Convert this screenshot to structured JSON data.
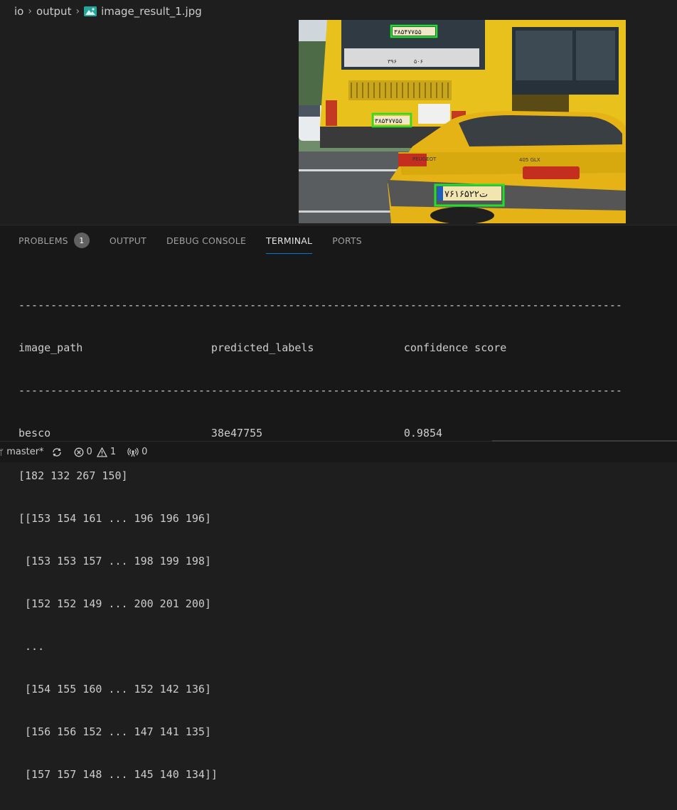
{
  "breadcrumb": {
    "items": [
      "io",
      "output"
    ],
    "file": "image_result_1.jpg"
  },
  "image": {
    "plates": [
      "۳۸۵۴۷۷۵۵",
      "۳۸۵۴۷۷۵۵",
      "۷۶ت۱۶۵۲۲"
    ],
    "bus_text": [
      "۳۹۶",
      "۵۰۶"
    ]
  },
  "panel": {
    "tabs": [
      {
        "label": "PROBLEMS",
        "badge": "1"
      },
      {
        "label": "OUTPUT"
      },
      {
        "label": "DEBUG CONSOLE"
      },
      {
        "label": "TERMINAL",
        "active": true
      },
      {
        "label": "PORTS"
      }
    ],
    "terminal_lines": [
      "----------------------------------------------------------------------------------------------",
      "image_path                    predicted_labels              confidence score",
      "----------------------------------------------------------------------------------------------",
      "besco                         38e47755                      0.9854",
      "[182 132 267 150]",
      "[[153 154 161 ... 196 196 196]",
      " [153 153 157 ... 198 199 198]",
      " [152 152 149 ... 200 201 200]",
      " ...",
      " [154 155 160 ... 152 142 136]",
      " [156 156 152 ... 147 141 135]",
      " [157 157 148 ... 145 140 134]]"
    ]
  },
  "statusbar": {
    "branch": "master*",
    "errors": "0",
    "warnings": "1",
    "ports": "0"
  },
  "colors": {
    "accent": "#0078d4",
    "plate_box": "#22e02a",
    "bus_yellow": "#e8c11c"
  }
}
